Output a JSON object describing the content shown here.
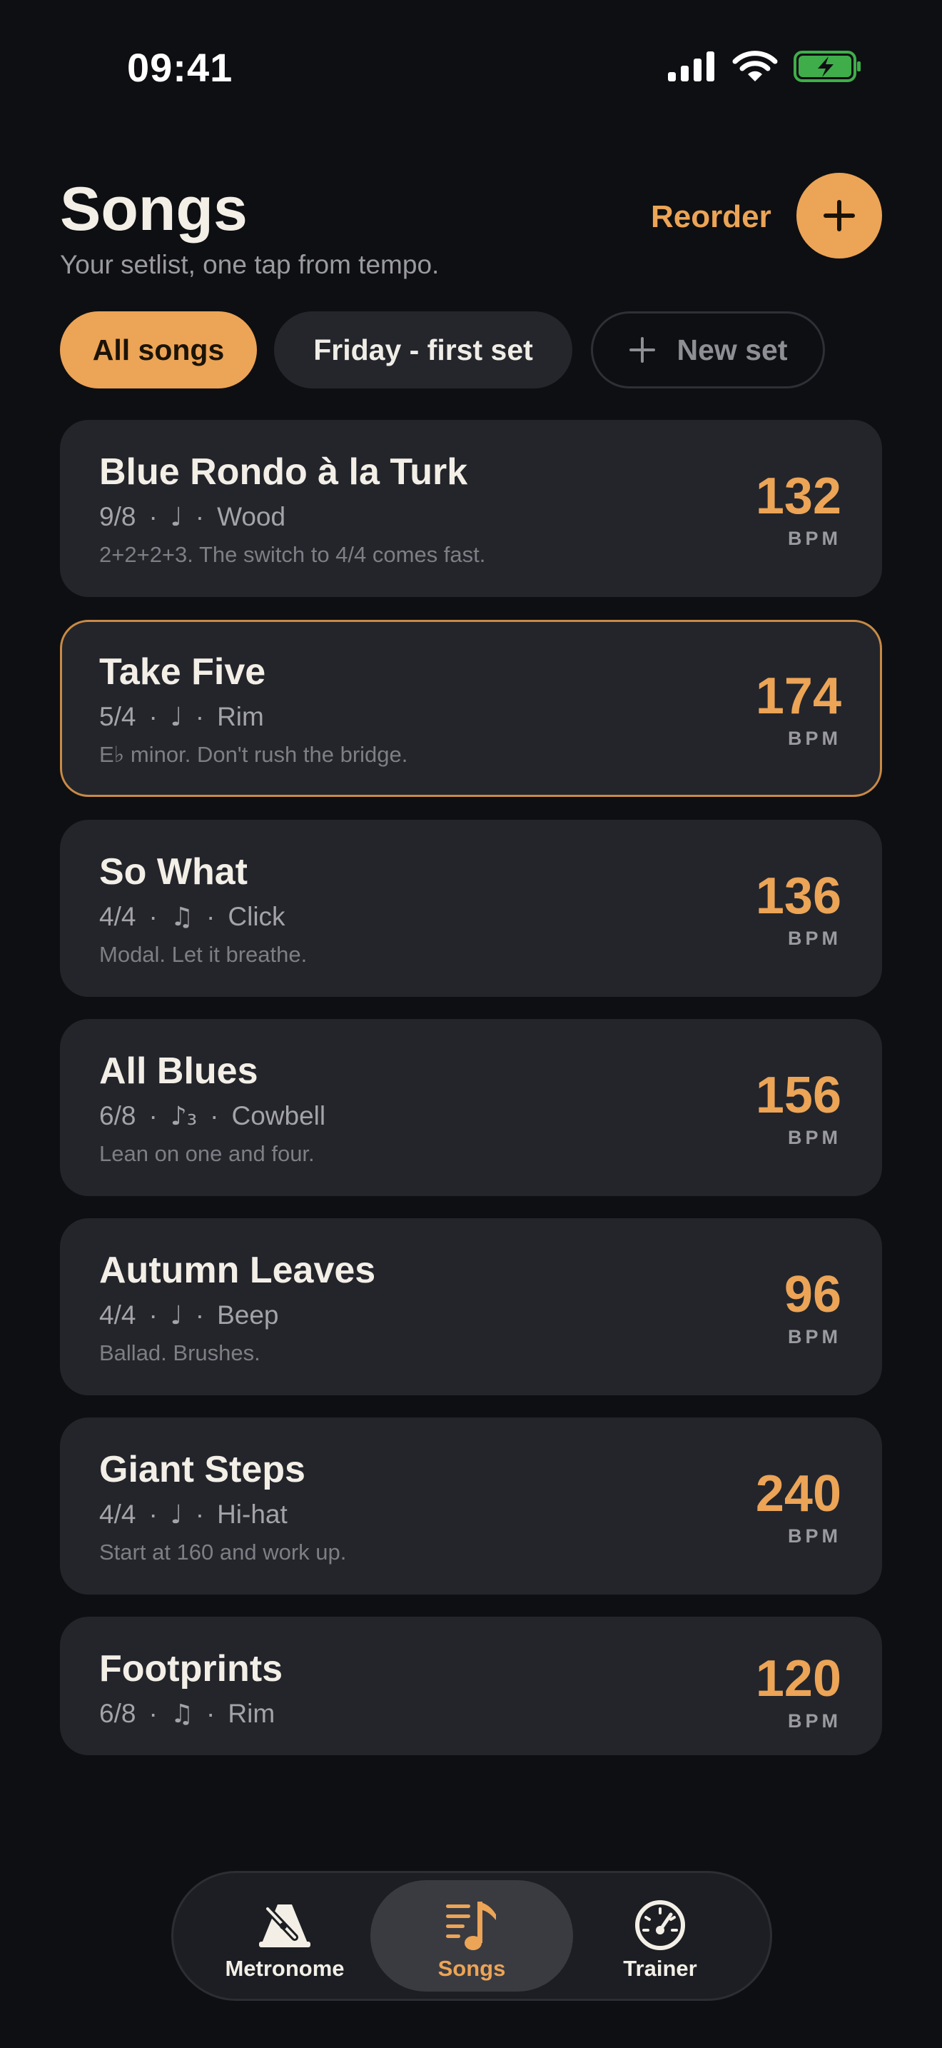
{
  "status": {
    "time": "09:41"
  },
  "header": {
    "title": "Songs",
    "subtitle": "Your setlist, one tap from tempo.",
    "reorder_label": "Reorder"
  },
  "chips": [
    {
      "label": "All songs",
      "selected": true
    },
    {
      "label": "Friday - first set",
      "selected": false
    },
    {
      "label": "New set",
      "selected": false
    }
  ],
  "songs": [
    {
      "title": "Blue Rondo à la Turk",
      "meter": "9/8",
      "note": "♩",
      "sound": "Wood",
      "comment": "2+2+2+3. The switch to 4/4 comes fast.",
      "bpm": "132",
      "bpm_label": "BPM"
    },
    {
      "title": "Take Five",
      "meter": "5/4",
      "note": "♩",
      "sound": "Rim",
      "comment": "E♭ minor. Don't rush the bridge.",
      "bpm": "174",
      "bpm_label": "BPM",
      "active": true
    },
    {
      "title": "So What",
      "meter": "4/4",
      "note": "♫",
      "sound": "Click",
      "comment": "Modal. Let it breathe.",
      "bpm": "136",
      "bpm_label": "BPM"
    },
    {
      "title": "All Blues",
      "meter": "6/8",
      "note": "♪₃",
      "sound": "Cowbell",
      "comment": "Lean on one and four.",
      "bpm": "156",
      "bpm_label": "BPM"
    },
    {
      "title": "Autumn Leaves",
      "meter": "4/4",
      "note": "♩",
      "sound": "Beep",
      "comment": "Ballad. Brushes.",
      "bpm": "96",
      "bpm_label": "BPM"
    },
    {
      "title": "Giant Steps",
      "meter": "4/4",
      "note": "♩",
      "sound": "Hi-hat",
      "comment": "Start at 160 and work up.",
      "bpm": "240",
      "bpm_label": "BPM"
    },
    {
      "title": "Footprints",
      "meter": "6/8",
      "note": "♫",
      "sound": "Rim",
      "comment": "",
      "bpm": "120",
      "bpm_label": "BPM"
    }
  ],
  "separator": "·",
  "tabs": [
    {
      "label": "Metronome",
      "icon": "metronome-icon"
    },
    {
      "label": "Songs",
      "icon": "music-note-list-icon",
      "selected": true
    },
    {
      "label": "Trainer",
      "icon": "speedometer-icon"
    }
  ],
  "colors": {
    "accent": "#eca456",
    "background": "#0e0f12",
    "card": "#23252b"
  }
}
